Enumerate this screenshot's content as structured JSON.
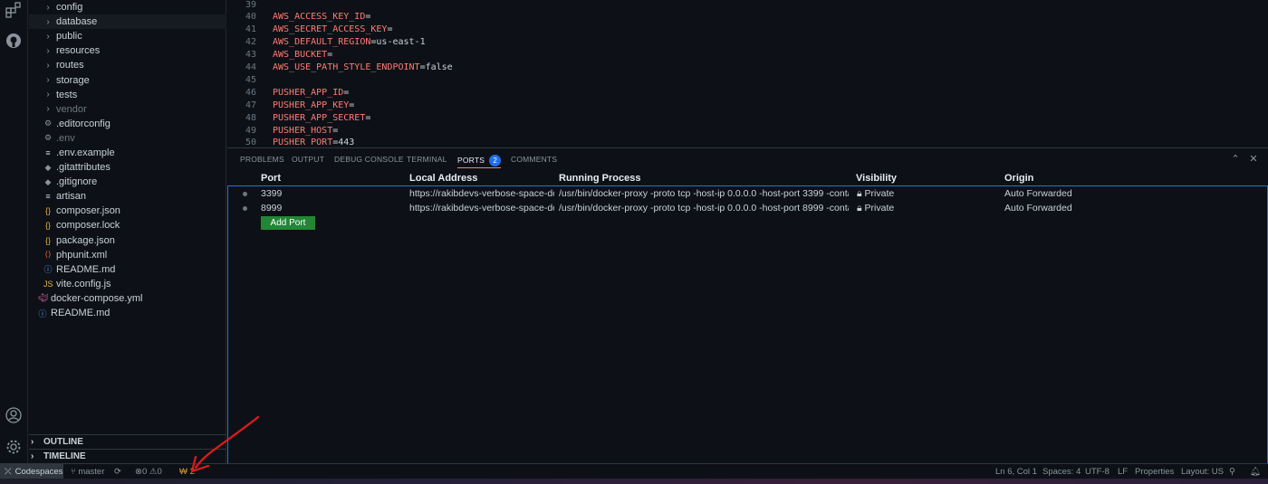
{
  "explorer": {
    "items": [
      {
        "name": "config",
        "type": "folder"
      },
      {
        "name": "database",
        "type": "folder",
        "selected": true
      },
      {
        "name": "public",
        "type": "folder"
      },
      {
        "name": "resources",
        "type": "folder"
      },
      {
        "name": "routes",
        "type": "folder"
      },
      {
        "name": "storage",
        "type": "folder"
      },
      {
        "name": "tests",
        "type": "folder"
      },
      {
        "name": "vendor",
        "type": "folder",
        "dim": true
      },
      {
        "name": ".editorconfig",
        "type": "gear"
      },
      {
        "name": ".env",
        "type": "gear",
        "dim": true
      },
      {
        "name": ".env.example",
        "type": "lines"
      },
      {
        "name": ".gitattributes",
        "type": "git"
      },
      {
        "name": ".gitignore",
        "type": "git"
      },
      {
        "name": "artisan",
        "type": "lines"
      },
      {
        "name": "composer.json",
        "type": "json"
      },
      {
        "name": "composer.lock",
        "type": "json"
      },
      {
        "name": "package.json",
        "type": "json"
      },
      {
        "name": "phpunit.xml",
        "type": "xml"
      },
      {
        "name": "README.md",
        "type": "info"
      },
      {
        "name": "vite.config.js",
        "type": "js"
      },
      {
        "name": "docker-compose.yml",
        "type": "docker",
        "root": true
      },
      {
        "name": "README.md",
        "type": "info",
        "root": true
      }
    ],
    "outline_label": "OUTLINE",
    "timeline_label": "TIMELINE"
  },
  "editor": {
    "lines": [
      {
        "num": "39",
        "key": "",
        "value": ""
      },
      {
        "num": "40",
        "key": "AWS_ACCESS_KEY_ID",
        "value": ""
      },
      {
        "num": "41",
        "key": "AWS_SECRET_ACCESS_KEY",
        "value": ""
      },
      {
        "num": "42",
        "key": "AWS_DEFAULT_REGION",
        "value": "us-east-1"
      },
      {
        "num": "43",
        "key": "AWS_BUCKET",
        "value": ""
      },
      {
        "num": "44",
        "key": "AWS_USE_PATH_STYLE_ENDPOINT",
        "value": "false"
      },
      {
        "num": "45",
        "key": "",
        "value": ""
      },
      {
        "num": "46",
        "key": "PUSHER_APP_ID",
        "value": ""
      },
      {
        "num": "47",
        "key": "PUSHER_APP_KEY",
        "value": ""
      },
      {
        "num": "48",
        "key": "PUSHER_APP_SECRET",
        "value": ""
      },
      {
        "num": "49",
        "key": "PUSHER_HOST",
        "value": ""
      },
      {
        "num": "50",
        "key": "PUSHER_PORT",
        "value": "443"
      }
    ]
  },
  "panel": {
    "tabs": [
      {
        "label": "PROBLEMS"
      },
      {
        "label": "OUTPUT"
      },
      {
        "label": "DEBUG CONSOLE"
      },
      {
        "label": "TERMINAL"
      },
      {
        "label": "PORTS",
        "badge": "2",
        "active": true
      },
      {
        "label": "COMMENTS"
      }
    ],
    "columns": [
      "Port",
      "Local Address",
      "Running Process",
      "Visibility",
      "Origin"
    ],
    "rows": [
      {
        "port": "3399",
        "address": "https://rakibdevs-verbose-space-do...",
        "process": "/usr/bin/docker-proxy -proto tcp -host-ip 0.0.0.0 -host-port 3399 -contain...",
        "visibility": "Private",
        "origin": "Auto Forwarded"
      },
      {
        "port": "8999",
        "address": "https://rakibdevs-verbose-space-do...",
        "process": "/usr/bin/docker-proxy -proto tcp -host-ip 0.0.0.0 -host-port 8999 -contain...",
        "visibility": "Private",
        "origin": "Auto Forwarded"
      }
    ],
    "add_port_label": "Add Port"
  },
  "status": {
    "remote": "Codespaces",
    "branch": "master",
    "errors": "0",
    "warnings": "0",
    "ports": "2",
    "position": "Ln 6, Col 1",
    "spaces": "Spaces: 4",
    "encoding": "UTF-8",
    "eol": "LF",
    "language": "Properties",
    "layout": "Layout: US"
  },
  "colors": {
    "accent": "#1f6feb",
    "add_button": "#238636",
    "env_key": "#ff7b72",
    "annotation": "#e01b1b"
  }
}
